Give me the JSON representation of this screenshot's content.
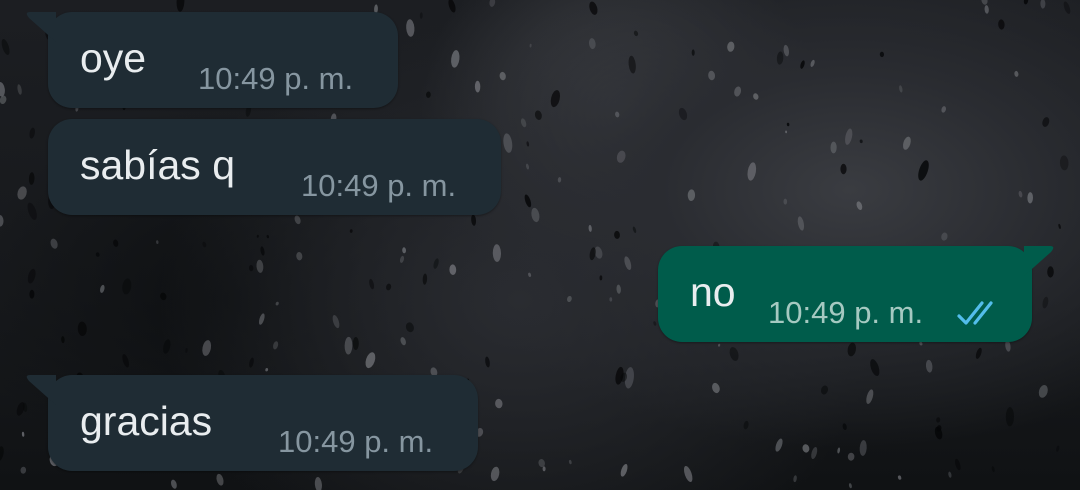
{
  "conversation": {
    "messages": [
      {
        "direction": "incoming",
        "text": "oye",
        "time": "10:49 p. m."
      },
      {
        "direction": "incoming",
        "text": "sabías q",
        "time": "10:49 p. m."
      },
      {
        "direction": "outgoing",
        "text": "no",
        "time": "10:49 p. m.",
        "status_icon": "double-check-read-icon"
      },
      {
        "direction": "incoming",
        "text": "gracias",
        "time": "10:49 p. m."
      }
    ]
  },
  "colors": {
    "incoming_bubble": "#1f2c34",
    "outgoing_bubble": "#005c4b",
    "message_text": "#e9edef",
    "timestamp_incoming": "#8696a0",
    "timestamp_outgoing": "#a5c9c1",
    "read_ticks": "#53bdeb"
  }
}
